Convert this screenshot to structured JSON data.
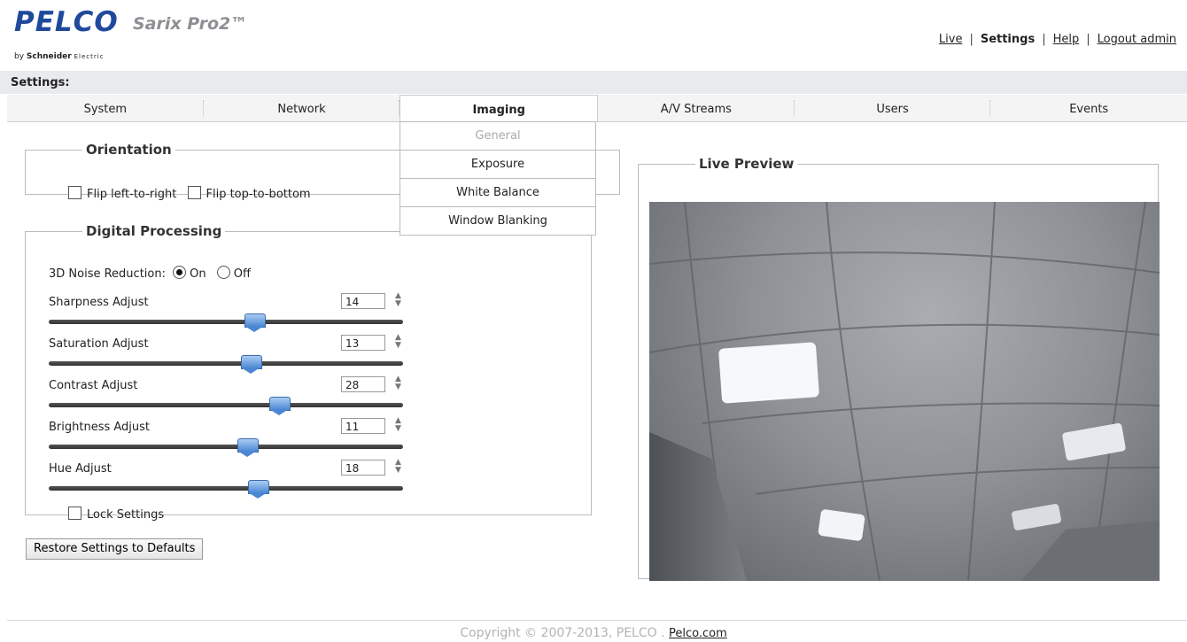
{
  "header": {
    "brand": "PELCO",
    "product": "Sarix Pro2™",
    "by_prefix": "by",
    "by_company": "Schneider",
    "by_suffix": "Electric",
    "links": {
      "live": "Live",
      "settings": "Settings",
      "help": "Help",
      "logout": "Logout admin"
    },
    "separator": "|"
  },
  "settings_bar": {
    "title": "Settings:"
  },
  "tabs": [
    {
      "label": "System"
    },
    {
      "label": "Network"
    },
    {
      "label": "Imaging",
      "active": true
    },
    {
      "label": "A/V Streams"
    },
    {
      "label": "Users"
    },
    {
      "label": "Events"
    }
  ],
  "submenu": {
    "items": [
      {
        "label": "General",
        "disabled": true
      },
      {
        "label": "Exposure"
      },
      {
        "label": "White Balance"
      },
      {
        "label": "Window Blanking"
      }
    ]
  },
  "orientation": {
    "title": "Orientation",
    "flip_lr": "Flip left-to-right",
    "flip_tb": "Flip top-to-bottom"
  },
  "digital": {
    "title": "Digital Processing",
    "noise_label": "3D Noise Reduction:",
    "noise_on": "On",
    "noise_off": "Off",
    "noise_value": "On",
    "adjustments": [
      {
        "label": "Sharpness Adjust",
        "value": "14",
        "level": 0.58
      },
      {
        "label": "Saturation Adjust",
        "value": "13",
        "level": 0.57
      },
      {
        "label": "Contrast Adjust",
        "value": "28",
        "level": 0.65
      },
      {
        "label": "Brightness Adjust",
        "value": "11",
        "level": 0.56
      },
      {
        "label": "Hue Adjust",
        "value": "18",
        "level": 0.59
      }
    ],
    "lock_label": "Lock Settings"
  },
  "restore_label": "Restore Settings to Defaults",
  "preview": {
    "title": "Live Preview"
  },
  "footer": {
    "copyright": "Copyright © 2007-2013, PELCO .",
    "link": "Pelco.com"
  },
  "colors": {
    "brand": "#1f4a9c",
    "slider_thumb": "#4a86d3",
    "settings_bar": "#e8eaee"
  }
}
